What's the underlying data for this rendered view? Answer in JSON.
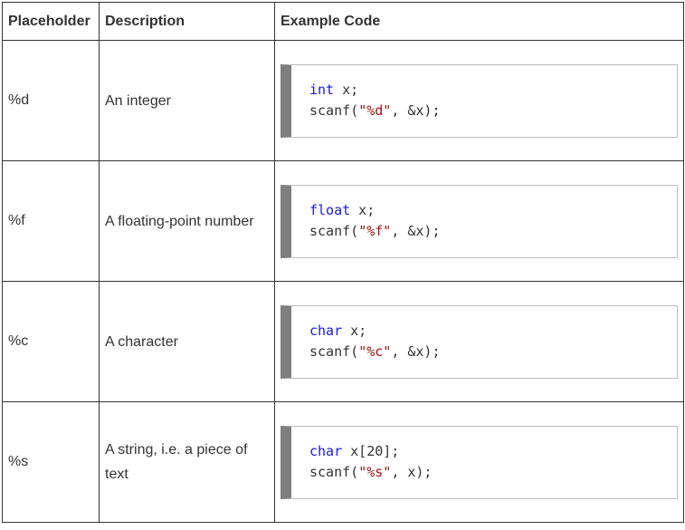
{
  "header": {
    "placeholder": "Placeholder",
    "description": "Description",
    "example": "Example Code"
  },
  "rows": [
    {
      "placeholder": "%d",
      "description": "An integer",
      "decl_type": "int",
      "decl_rest": " x;",
      "scan_fn": "scanf(",
      "scan_fmt": "\"%d\"",
      "scan_rest": ", &x);"
    },
    {
      "placeholder": "%f",
      "description": "A floating-point number",
      "decl_type": "float",
      "decl_rest": " x;",
      "scan_fn": "scanf(",
      "scan_fmt": "\"%f\"",
      "scan_rest": ", &x);"
    },
    {
      "placeholder": "%c",
      "description": "A character",
      "decl_type": "char",
      "decl_rest": " x;",
      "scan_fn": "scanf(",
      "scan_fmt": "\"%c\"",
      "scan_rest": ", &x);"
    },
    {
      "placeholder": "%s",
      "description": "A string, i.e. a piece of text",
      "decl_type": "char",
      "decl_rest": " x[20];",
      "scan_fn": "scanf(",
      "scan_fmt": "\"%s\"",
      "scan_rest": ", x);"
    }
  ],
  "colors": {
    "keyword": "#1a1ad6",
    "string": "#a31515",
    "code_bar": "#7f7f7f",
    "border": "#333333"
  }
}
